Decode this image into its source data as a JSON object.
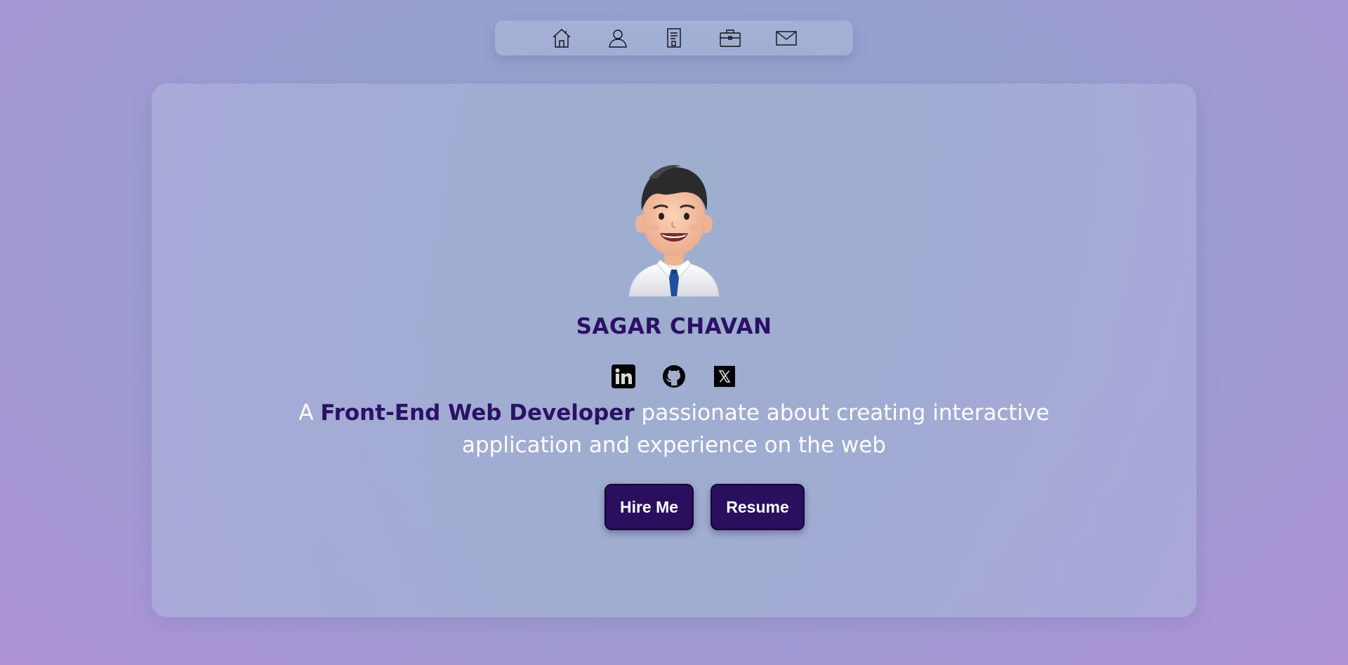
{
  "nav": {
    "items": [
      {
        "icon": "home-icon"
      },
      {
        "icon": "user-icon"
      },
      {
        "icon": "document-icon"
      },
      {
        "icon": "briefcase-icon"
      },
      {
        "icon": "mail-icon"
      }
    ]
  },
  "profile": {
    "name": "SAGAR CHAVAN",
    "avatar_icon": "avatar-illustration"
  },
  "socials": [
    {
      "icon": "linkedin-icon"
    },
    {
      "icon": "github-icon"
    },
    {
      "icon": "x-twitter-icon"
    }
  ],
  "tagline": {
    "prefix": "A ",
    "highlight": "Front-End Web Developer",
    "suffix": " passionate about creating interactive application and experience on the web"
  },
  "buttons": {
    "hire_label": "Hire Me",
    "resume_label": "Resume"
  },
  "colors": {
    "accent": "#2b1166",
    "button_bg": "#2a0f5e",
    "text_light": "#ffffff"
  }
}
